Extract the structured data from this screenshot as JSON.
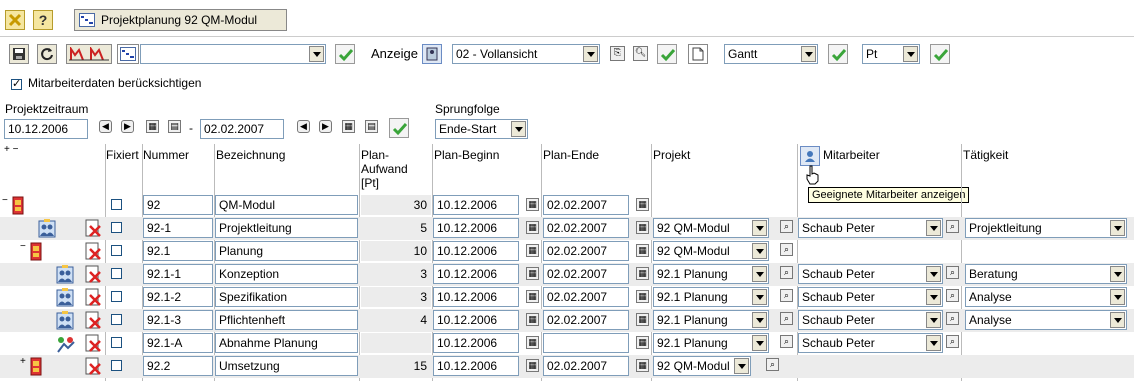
{
  "toolbar_top": {
    "tab_title": "Projektplanung 92 QM-Modul"
  },
  "toolbar_main": {
    "project_select_value": "",
    "anzeige_label": "Anzeige",
    "anzeige_value": "02 - Vollansicht",
    "view_value": "Gantt",
    "unit_value": "Pt"
  },
  "options": {
    "mitarbeiterdaten_label": "Mitarbeiterdaten berücksichtigen"
  },
  "zeitraum": {
    "label": "Projektzeitraum",
    "from": "10.12.2006",
    "separator": "-",
    "to": "02.02.2007"
  },
  "sprungfolge": {
    "label": "Sprungfolge",
    "value": "Ende-Start"
  },
  "table": {
    "expand_collapse": "+ −",
    "headers": {
      "fixiert": "Fixiert",
      "nummer": "Nummer",
      "bezeichnung": "Bezeichnung",
      "aufwand": "Plan-\nAufwand\n[Pt]",
      "beginn": "Plan-Beginn",
      "ende": "Plan-Ende",
      "projekt": "Projekt",
      "mitarbeiter": "Mitarbeiter",
      "taetigkeit": "Tätigkeit"
    },
    "tooltip": "Geeignete Mitarbeiter anzeigen",
    "rows": [
      {
        "nummer": "92",
        "bezeichnung": "QM-Modul",
        "aufwand": "30",
        "beginn": "10.12.2006",
        "ende": "02.02.2007",
        "projekt": "",
        "mitarbeiter": "",
        "taetigkeit": ""
      },
      {
        "nummer": "92-1",
        "bezeichnung": "Projektleitung",
        "aufwand": "5",
        "beginn": "10.12.2006",
        "ende": "02.02.2007",
        "projekt": "92 QM-Modul",
        "mitarbeiter": "Schaub Peter",
        "taetigkeit": "Projektleitung"
      },
      {
        "nummer": "92.1",
        "bezeichnung": "Planung",
        "aufwand": "10",
        "beginn": "10.12.2006",
        "ende": "02.02.2007",
        "projekt": "92 QM-Modul",
        "mitarbeiter": "",
        "taetigkeit": ""
      },
      {
        "nummer": "92.1-1",
        "bezeichnung": "Konzeption",
        "aufwand": "3",
        "beginn": "10.12.2006",
        "ende": "02.02.2007",
        "projekt": "92.1 Planung",
        "mitarbeiter": "Schaub Peter",
        "taetigkeit": "Beratung"
      },
      {
        "nummer": "92.1-2",
        "bezeichnung": "Spezifikation",
        "aufwand": "3",
        "beginn": "10.12.2006",
        "ende": "02.02.2007",
        "projekt": "92.1 Planung",
        "mitarbeiter": "Schaub Peter",
        "taetigkeit": "Analyse"
      },
      {
        "nummer": "92.1-3",
        "bezeichnung": "Pflichtenheft",
        "aufwand": "4",
        "beginn": "10.12.2006",
        "ende": "02.02.2007",
        "projekt": "92.1 Planung",
        "mitarbeiter": "Schaub Peter",
        "taetigkeit": "Analyse"
      },
      {
        "nummer": "92.1-A",
        "bezeichnung": "Abnahme Planung",
        "aufwand": "",
        "beginn": "10.12.2006",
        "ende": "",
        "projekt": "92.1 Planung",
        "mitarbeiter": "Schaub Peter",
        "taetigkeit": ""
      },
      {
        "nummer": "92.2",
        "bezeichnung": "Umsetzung",
        "aufwand": "15",
        "beginn": "10.12.2006",
        "ende": "02.02.2007",
        "projekt": "92 QM-Modul",
        "mitarbeiter": "",
        "taetigkeit": ""
      }
    ]
  },
  "colors": {
    "accent_green": "#3aa53a",
    "row_grey": "#ececec",
    "toolbar_bg": "#ece9d8",
    "tooltip_bg": "#ffffe1"
  }
}
